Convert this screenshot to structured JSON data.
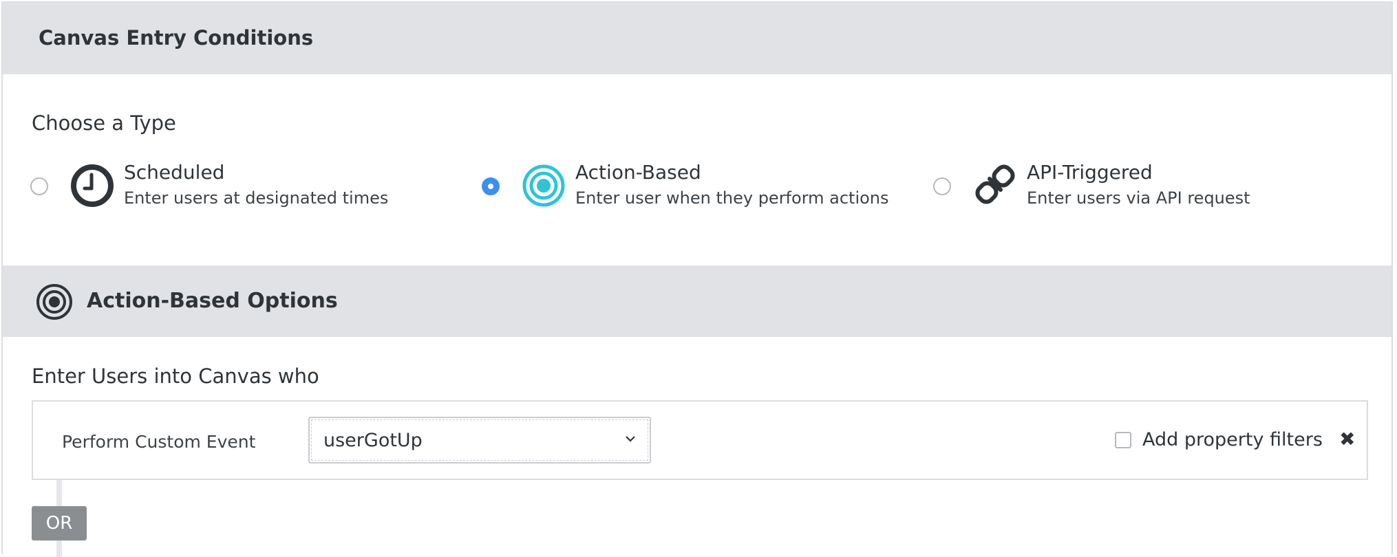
{
  "header": {
    "title": "Canvas Entry Conditions"
  },
  "choose_type": {
    "label": "Choose a Type",
    "options": [
      {
        "title": "Scheduled",
        "description": "Enter users at designated times",
        "icon": "clock-icon",
        "selected": false
      },
      {
        "title": "Action-Based",
        "description": "Enter user when they perform actions",
        "icon": "target-icon",
        "selected": true
      },
      {
        "title": "API-Triggered",
        "description": "Enter users via API request",
        "icon": "link-icon",
        "selected": false
      }
    ]
  },
  "action_options": {
    "title": "Action-Based Options",
    "icon": "target-icon",
    "enter_label": "Enter Users into Canvas who",
    "event_row": {
      "action_label": "Perform Custom Event",
      "selected_event": "userGotUp",
      "filter_label": "Add property filters",
      "filter_checked": false,
      "remove_icon": "close-icon"
    },
    "or_label": "OR"
  },
  "colors": {
    "accent_blue": "#3b8ff0",
    "target_teal": "#2ec4d6",
    "header_bg": "#e1e2e6"
  }
}
